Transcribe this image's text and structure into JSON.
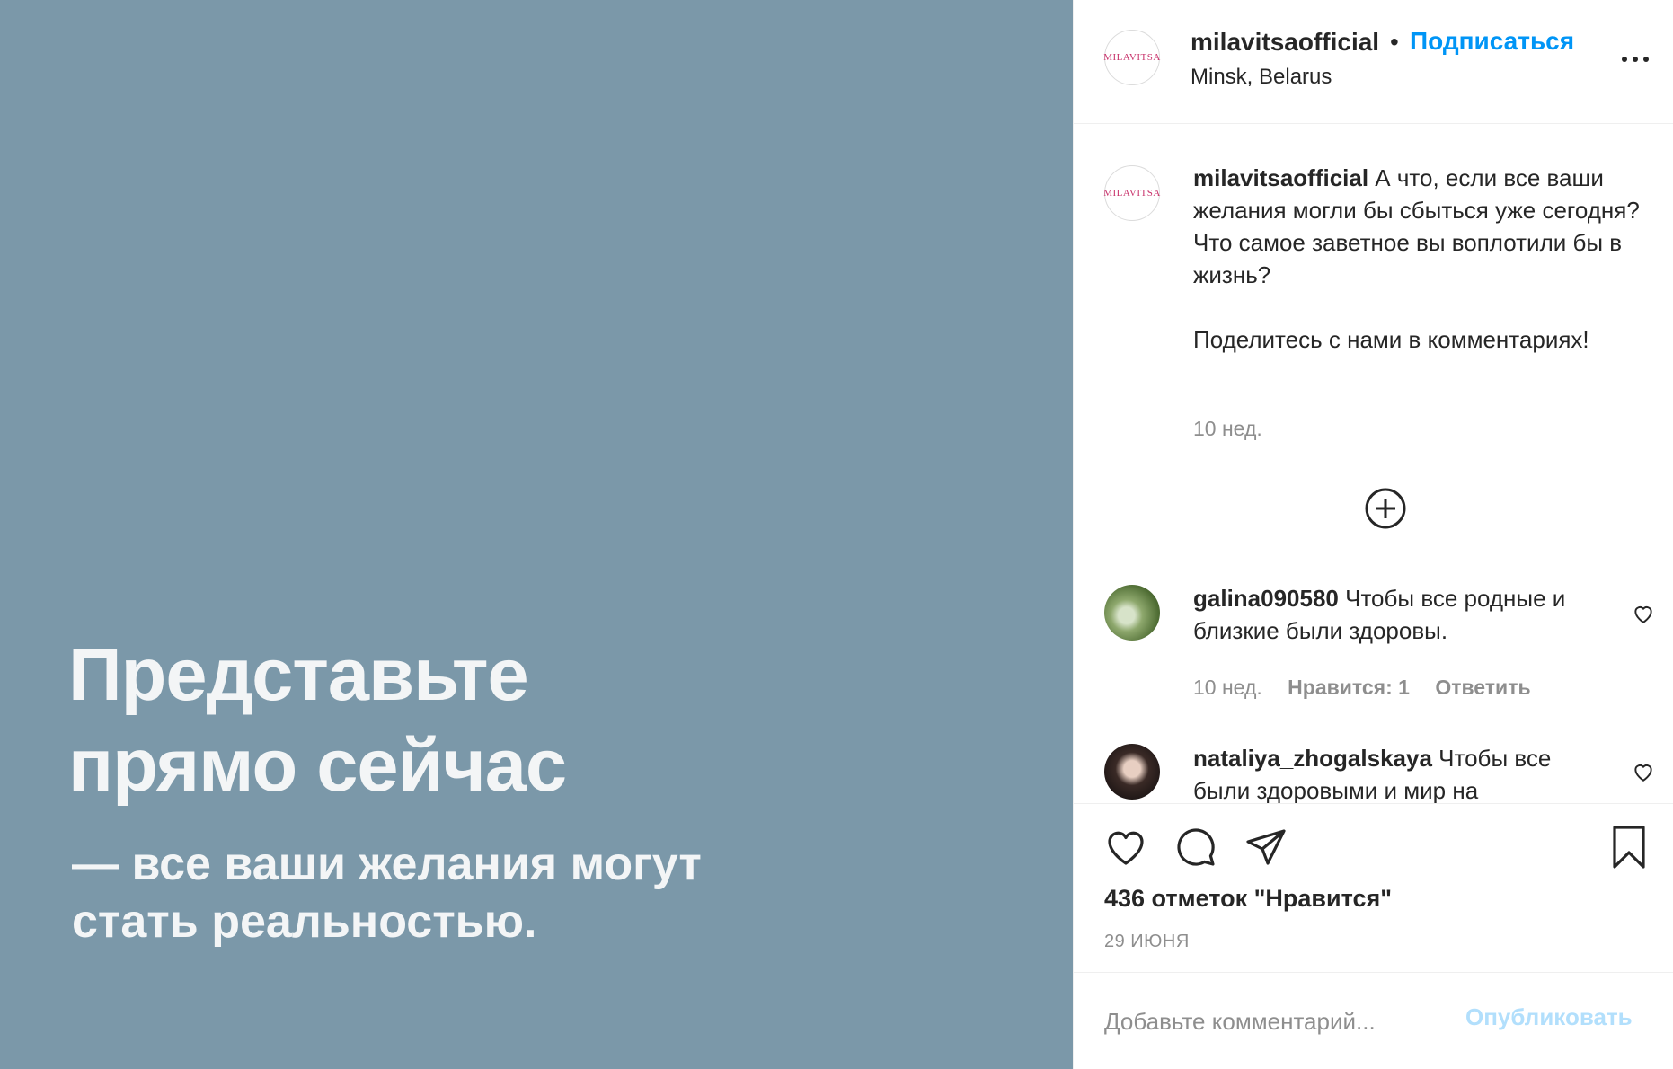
{
  "post": {
    "headline_line1": "Представьте",
    "headline_line2": "прямо сейчас",
    "subline_line1": "— все ваши желания могут",
    "subline_line2": "стать реальностью.",
    "background_color": "#7b98a9"
  },
  "header": {
    "username": "milavitsaofficial",
    "separator": "•",
    "follow_label": "Подписаться",
    "location": "Minsk, Belarus",
    "logo_text": "MILAVITSA"
  },
  "caption": {
    "username": "milavitsaofficial",
    "text": " А что, если все ваши желания могли бы сбыться уже сегодня?\nЧто самое заветное вы воплотили бы в жизнь?\n\nПоделитесь с нами в комментариях!",
    "time": "10 нед."
  },
  "comments": [
    {
      "username": "galina090580",
      "text": " Чтобы все родные и близкие были здоровы.",
      "time": "10 нед.",
      "likes_label": "Нравится: 1",
      "reply_label": "Ответить"
    },
    {
      "username": "nataliya_zhogalskaya",
      "text": " Чтобы все были здоровыми и мир на"
    }
  ],
  "actions": {
    "likes_text": "436 отметок \"Нравится\"",
    "date": "29 ИЮНЯ"
  },
  "add_comment": {
    "placeholder": "Добавьте комментарий...",
    "publish_label": "Опубликовать"
  },
  "colors": {
    "accent": "#0095f6",
    "accent_disabled": "#b2dffc",
    "muted": "#8e8e8e",
    "text": "#262626"
  },
  "icons": [
    "more-options-icon",
    "plus-circle-icon",
    "heart-icon",
    "comment-icon",
    "share-icon",
    "bookmark-icon"
  ]
}
